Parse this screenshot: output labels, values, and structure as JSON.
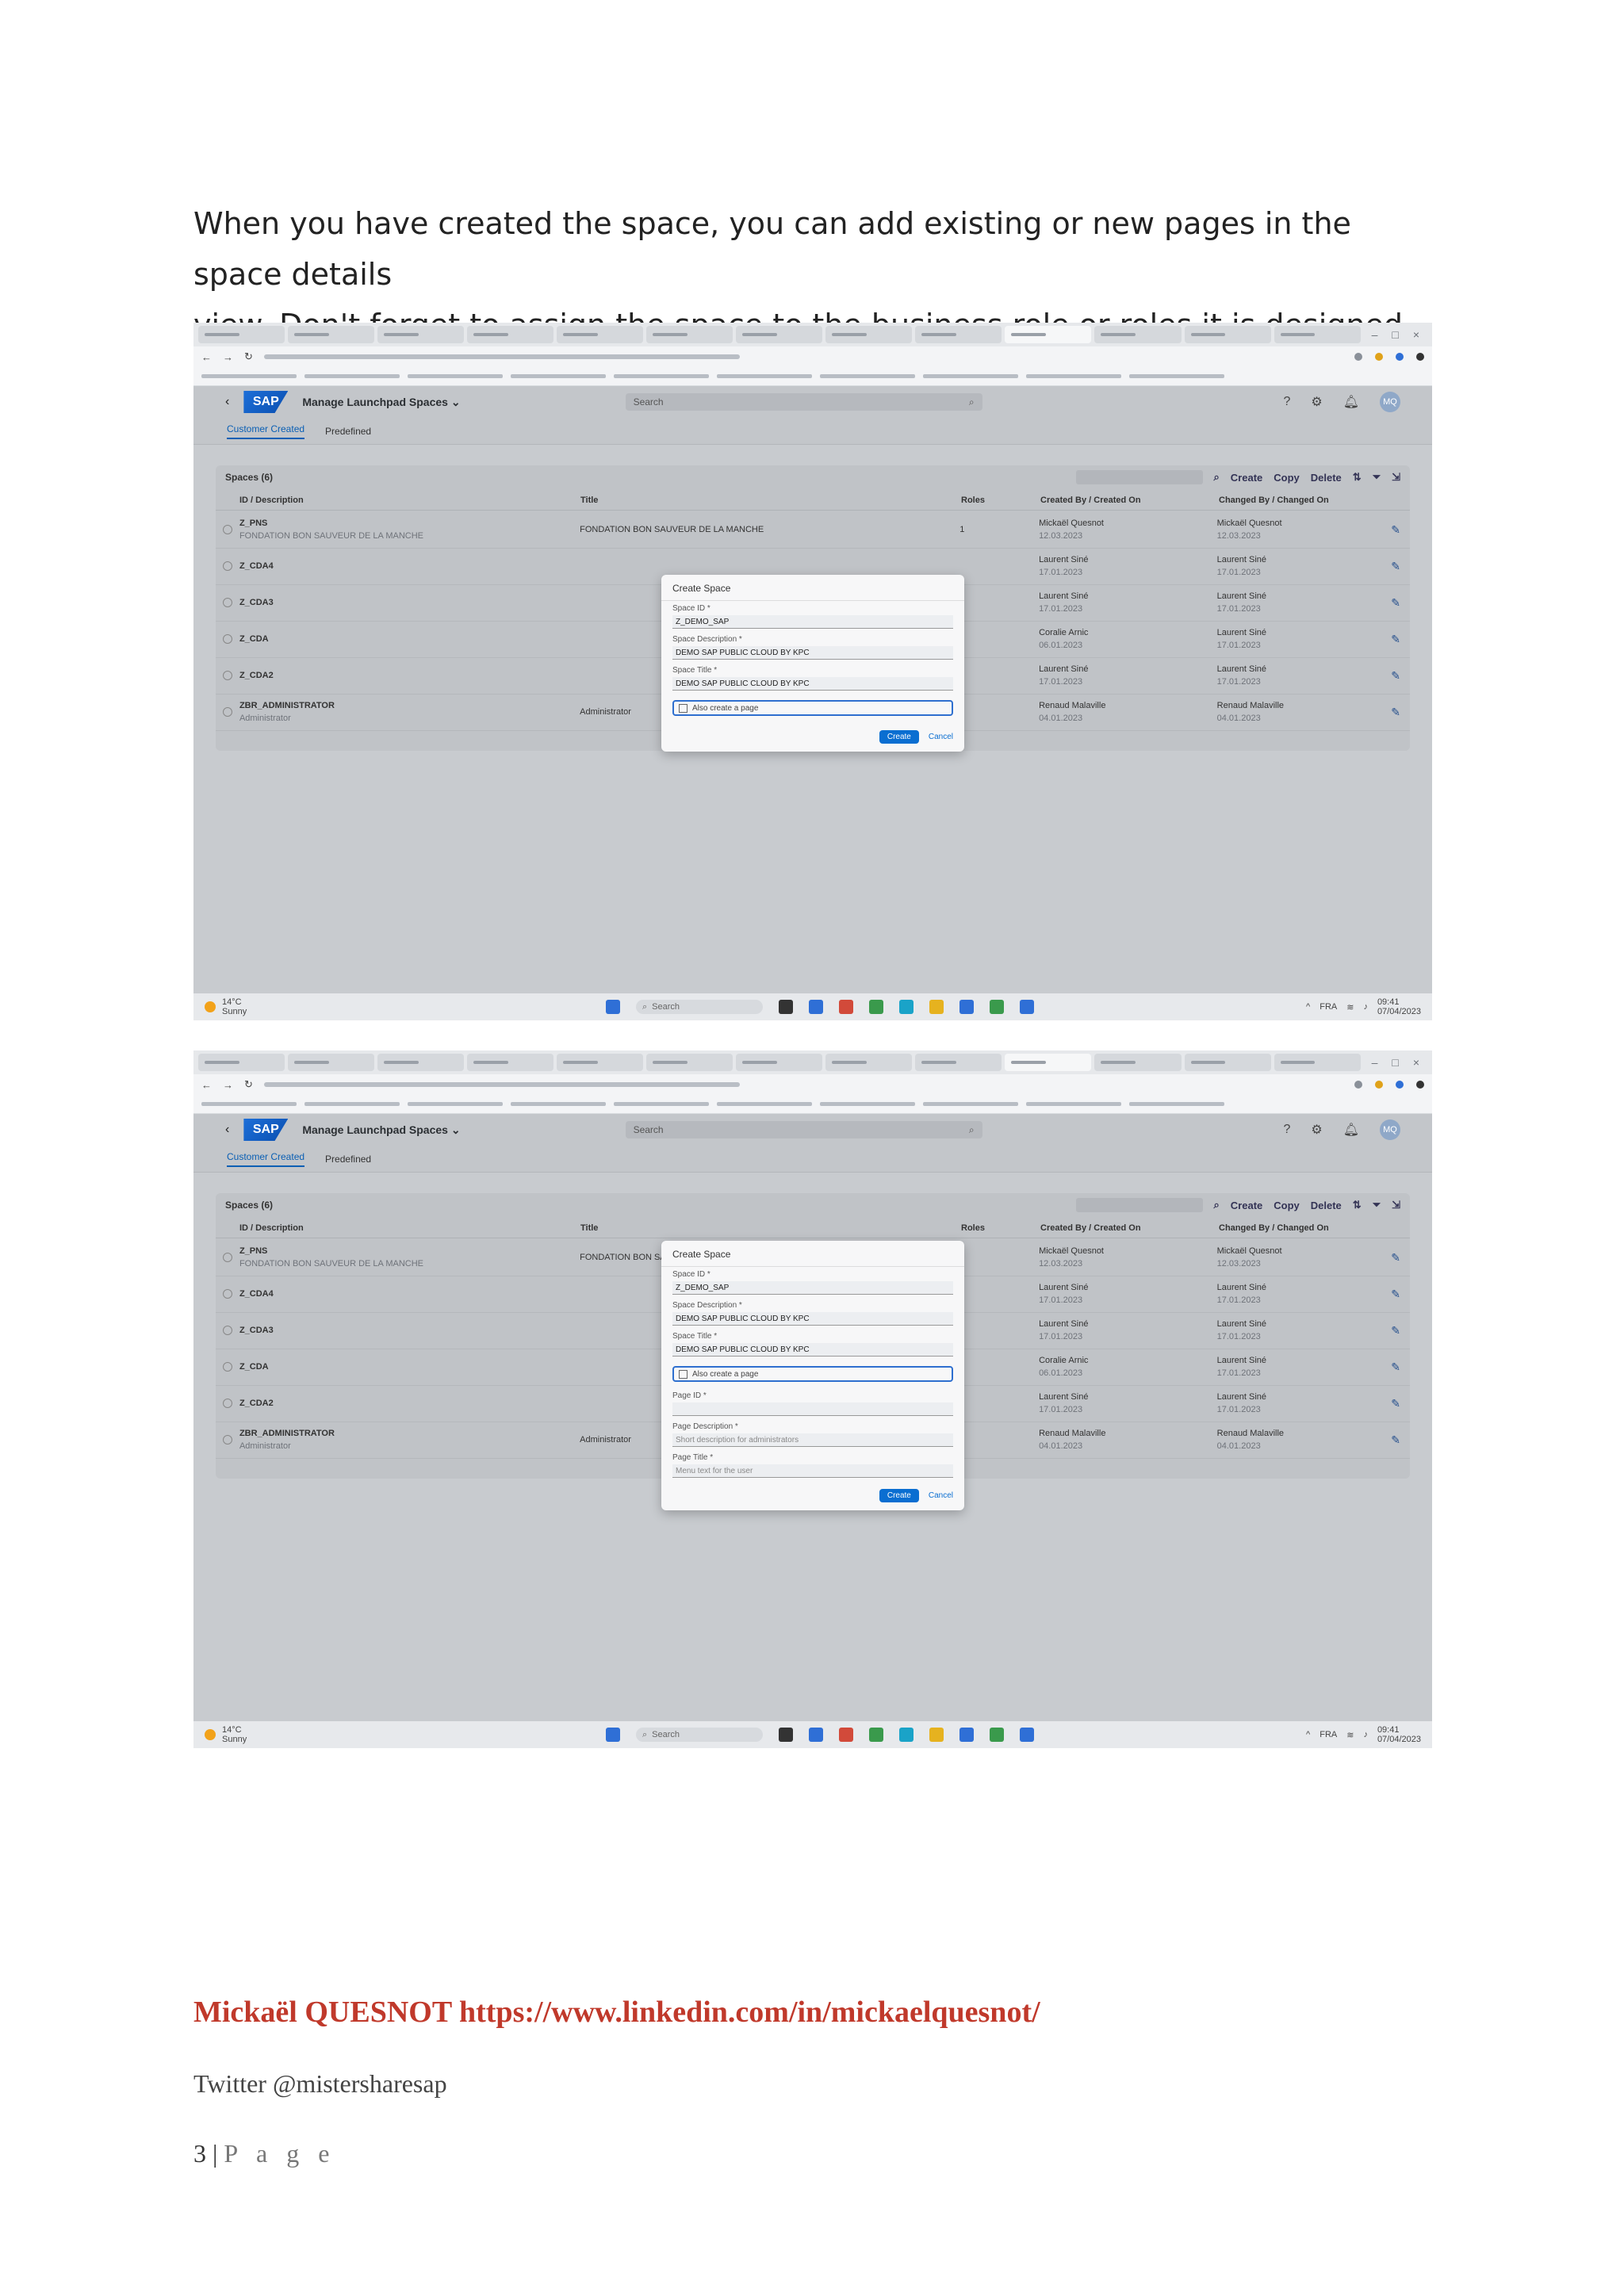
{
  "intro": {
    "line1": "When you have created the space, you can add existing or new pages in the space details",
    "line2": "view. Don't forget to assign the space to the business role or roles it is designed for."
  },
  "app": {
    "logo": "SAP",
    "title": "Manage Launchpad Spaces ⌄",
    "search_placeholder": "Search",
    "avatar": "MQ",
    "subtabs": [
      "Customer Created",
      "Predefined"
    ],
    "table_title": "Spaces (6)",
    "tools": [
      "Create",
      "Copy",
      "Delete"
    ],
    "columns": [
      "ID / Description",
      "Title",
      "Roles",
      "Created By / Created On",
      "Changed By / Changed On"
    ],
    "rows": [
      {
        "id": "Z_PNS",
        "desc": "FONDATION BON SAUVEUR DE LA MANCHE",
        "title": "FONDATION BON SAUVEUR DE LA MANCHE",
        "roles": "1",
        "created_by": "Mickaël Quesnot",
        "created_on": "12.03.2023",
        "changed_by": "Mickaël Quesnot",
        "changed_on": "12.03.2023"
      },
      {
        "id": "Z_CDA4",
        "desc": "",
        "title": "",
        "roles": "",
        "created_by": "Laurent Siné",
        "created_on": "17.01.2023",
        "changed_by": "Laurent Siné",
        "changed_on": "17.01.2023"
      },
      {
        "id": "Z_CDA3",
        "desc": "",
        "title": "",
        "roles": "",
        "created_by": "Laurent Siné",
        "created_on": "17.01.2023",
        "changed_by": "Laurent Siné",
        "changed_on": "17.01.2023"
      },
      {
        "id": "Z_CDA",
        "desc": "",
        "title": "",
        "roles": "",
        "created_by": "Coralie Arnic",
        "created_on": "06.01.2023",
        "changed_by": "Laurent Siné",
        "changed_on": "17.01.2023"
      },
      {
        "id": "Z_CDA2",
        "desc": "",
        "title": "",
        "roles": "",
        "created_by": "Laurent Siné",
        "created_on": "17.01.2023",
        "changed_by": "Laurent Siné",
        "changed_on": "17.01.2023"
      },
      {
        "id": "ZBR_ADMINISTRATOR",
        "desc": "Administrator",
        "title": "Administrator",
        "roles": "",
        "created_by": "Renaud Malaville",
        "created_on": "04.01.2023",
        "changed_by": "Renaud Malaville",
        "changed_on": "04.01.2023"
      }
    ]
  },
  "dialog": {
    "title": "Create Space",
    "space_id_label": "Space ID *",
    "space_id_value": "Z_DEMO_SAP",
    "space_desc_label": "Space Description *",
    "space_desc_value": "DEMO SAP PUBLIC CLOUD BY KPC",
    "space_title_label": "Space Title *",
    "space_title_value": "DEMO SAP PUBLIC CLOUD BY KPC",
    "checkbox_label": "Also create a page",
    "page_id_label": "Page ID *",
    "page_desc_label": "Page Description *",
    "page_desc_placeholder": "Short description for administrators",
    "page_title_label": "Page Title *",
    "page_title_placeholder": "Menu text for the user",
    "create": "Create",
    "cancel": "Cancel"
  },
  "taskbar": {
    "weather_temp": "14°C",
    "weather_desc": "Sunny",
    "search": "Search",
    "lang": "FRA",
    "time": "09:41",
    "date": "07/04/2023"
  },
  "footer": {
    "author": "Mickaël QUESNOT https://www.linkedin.com/in/mickaelquesnot/",
    "twitter": "Twitter @mistersharesap",
    "page_number": "3",
    "page_label": "P a g e"
  }
}
